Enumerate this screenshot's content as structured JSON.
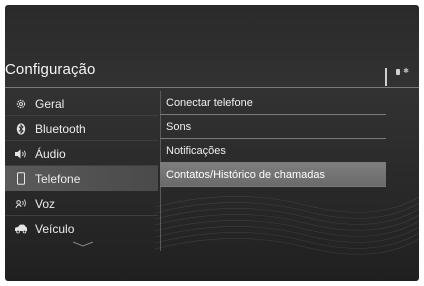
{
  "header": {
    "title": "Configuração"
  },
  "menu": {
    "items": [
      {
        "label": "Geral",
        "icon": "gear-icon"
      },
      {
        "label": "Bluetooth",
        "icon": "bluetooth-icon"
      },
      {
        "label": "Áudio",
        "icon": "speaker-icon"
      },
      {
        "label": "Telefone",
        "icon": "phone-icon",
        "selected": true
      },
      {
        "label": "Voz",
        "icon": "voice-icon"
      },
      {
        "label": "Veículo",
        "icon": "car-icon"
      }
    ]
  },
  "submenu": {
    "items": [
      {
        "label": "Conectar telefone"
      },
      {
        "label": "Sons"
      },
      {
        "label": "Notificações"
      },
      {
        "label": "Contatos/Histórico de chamadas",
        "selected": true
      }
    ]
  },
  "colors": {
    "background": "#2c2c2c",
    "selected": "#6f6f6f",
    "text": "#f0f0f0"
  }
}
